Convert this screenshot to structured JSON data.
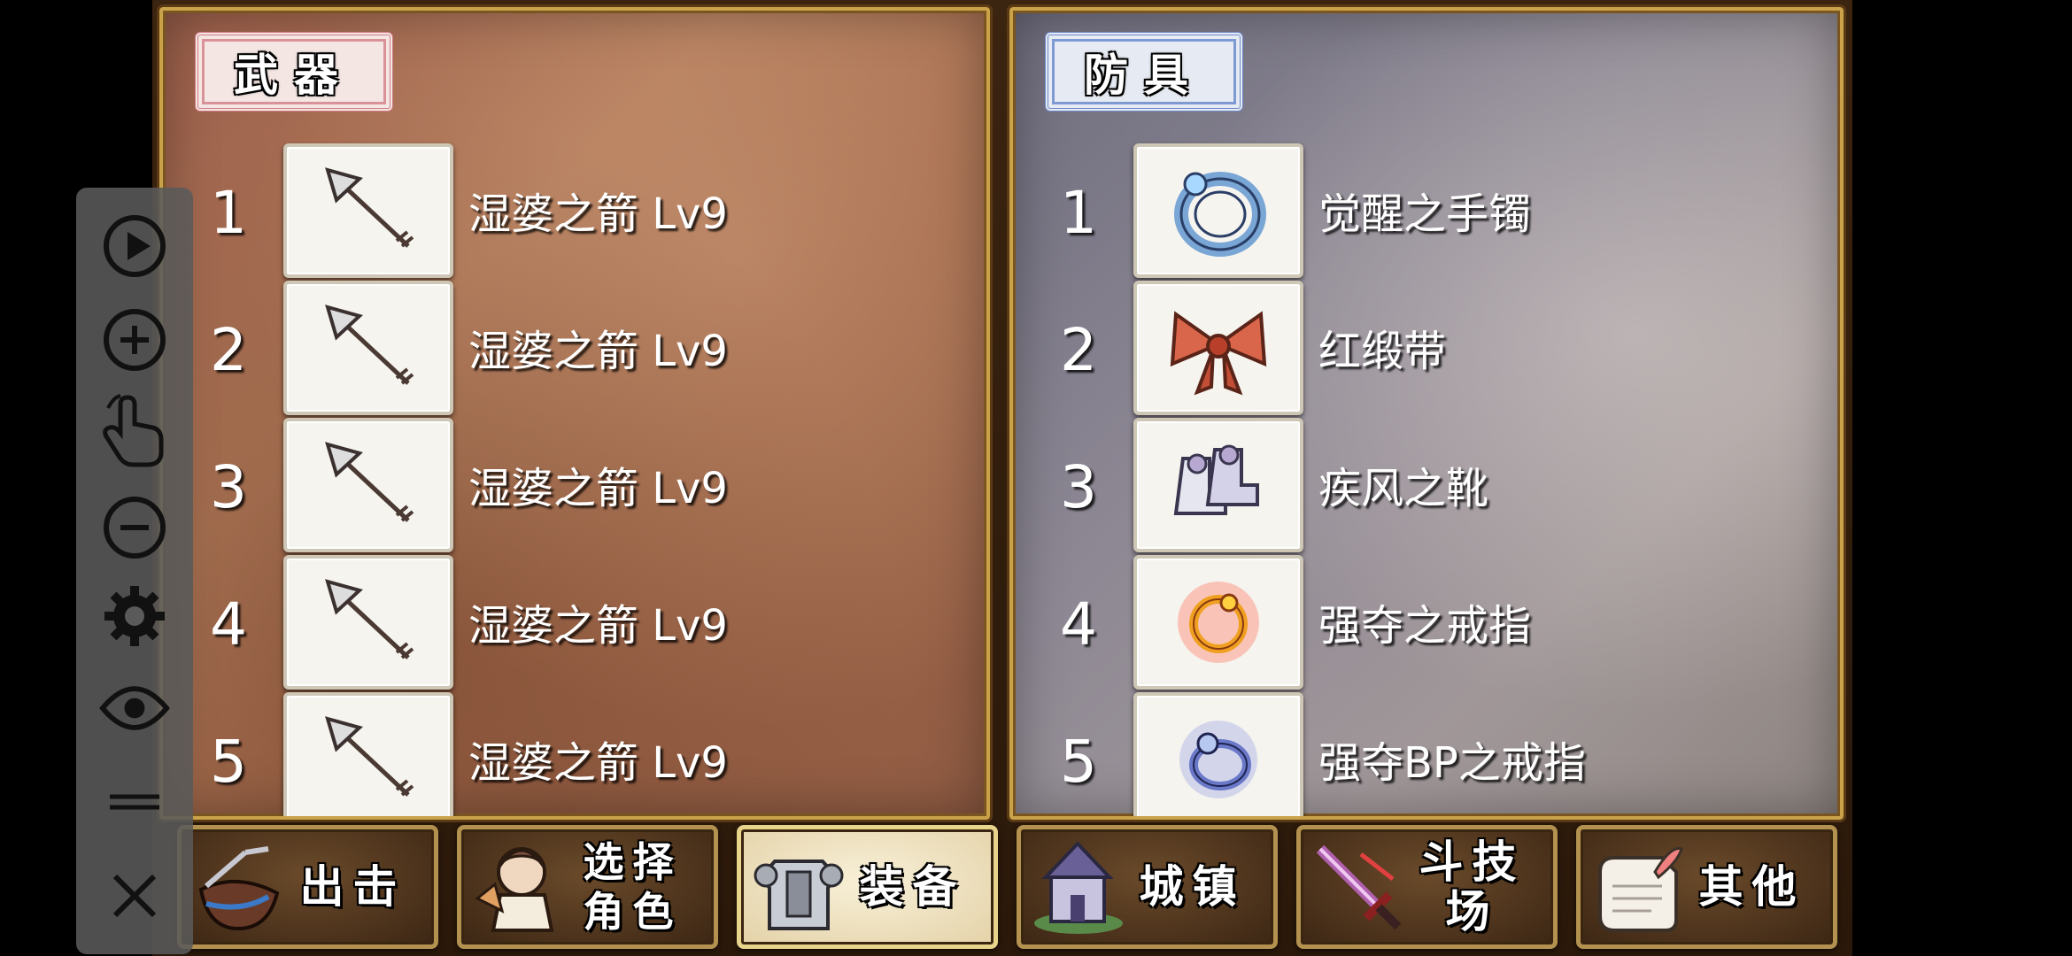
{
  "weapons": {
    "title": "武器",
    "slots": [
      {
        "num": "1",
        "name": "湿婆之箭 Lv9",
        "icon": "arrow-icon"
      },
      {
        "num": "2",
        "name": "湿婆之箭 Lv9",
        "icon": "arrow-icon"
      },
      {
        "num": "3",
        "name": "湿婆之箭 Lv9",
        "icon": "arrow-icon"
      },
      {
        "num": "4",
        "name": "湿婆之箭 Lv9",
        "icon": "arrow-icon"
      },
      {
        "num": "5",
        "name": "湿婆之箭 Lv9",
        "icon": "arrow-icon"
      }
    ]
  },
  "armor": {
    "title": "防具",
    "slots": [
      {
        "num": "1",
        "name": "觉醒之手镯",
        "icon": "bracelet-icon"
      },
      {
        "num": "2",
        "name": "红缎带",
        "icon": "ribbon-icon"
      },
      {
        "num": "3",
        "name": "疾风之靴",
        "icon": "boots-icon"
      },
      {
        "num": "4",
        "name": "强夺之戒指",
        "icon": "ring-icon"
      },
      {
        "num": "5",
        "name": "强夺BP之戒指",
        "icon": "bp-ring-icon"
      }
    ]
  },
  "tabs": [
    {
      "label": "出击",
      "icon": "sortie-icon",
      "active": false
    },
    {
      "label": "选择\n角色",
      "icon": "character-icon",
      "active": false
    },
    {
      "label": "装备",
      "icon": "armor-equip-icon",
      "active": true
    },
    {
      "label": "城镇",
      "icon": "town-icon",
      "active": false
    },
    {
      "label": "斗技场",
      "icon": "sword-icon",
      "active": false
    },
    {
      "label": "其他",
      "icon": "scroll-icon",
      "active": false
    }
  ],
  "toolbar": {
    "tools": [
      "play-icon",
      "zoom-in-icon",
      "tap-gesture-icon",
      "zoom-out-icon",
      "settings-icon",
      "eye-icon",
      "drag-handle-icon",
      "close-icon"
    ]
  },
  "colors": {
    "weapon_accent": "#d07c86",
    "armor_accent": "#6d8ac8",
    "frame_gold": "#c9a24a"
  }
}
